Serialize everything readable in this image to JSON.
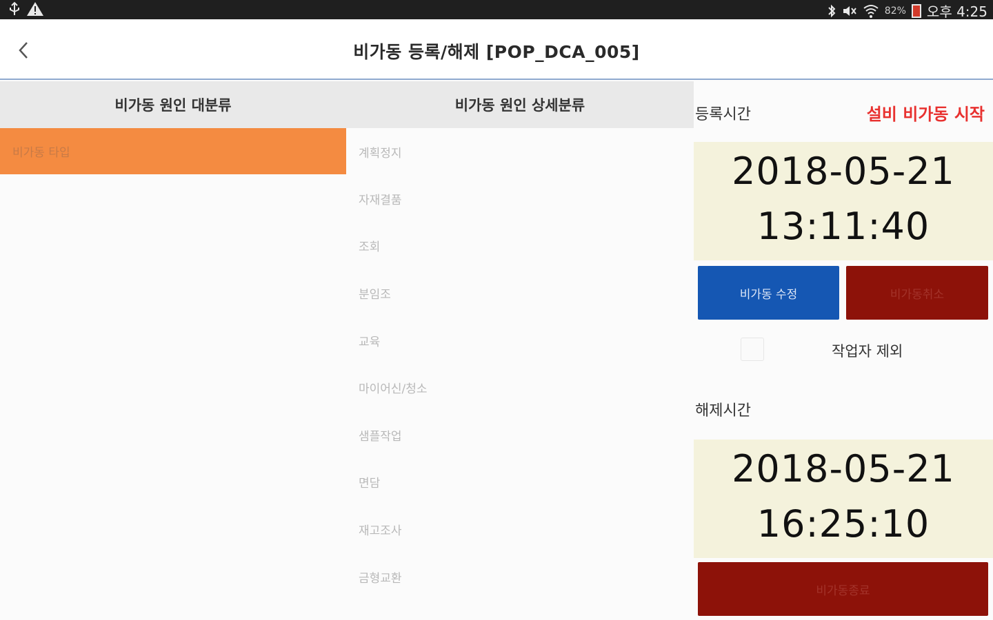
{
  "status_bar": {
    "left_icons": [
      "usb-icon",
      "warning-icon"
    ],
    "battery": "82%",
    "time": "오후 4:25",
    "right_icons": [
      "bluetooth-icon",
      "mute-icon",
      "wifi-icon",
      "battery-icon"
    ]
  },
  "app_bar": {
    "title": "비가동 등록/해제 [POP_DCA_005]",
    "back_icon": "chevron-left-icon"
  },
  "major": {
    "header": "비가동 원인 대분류",
    "items": [
      {
        "label": "비가동 타입",
        "selected": true
      }
    ],
    "accent_color": "#f48b41"
  },
  "detail": {
    "header": "비가동 원인 상세분류",
    "items": [
      "계획정지",
      "자재결품",
      "조회",
      "분임조",
      "교육",
      "마이어신/청소",
      "샘플작업",
      "면담",
      "재고조사",
      "금형교환"
    ]
  },
  "registration": {
    "label": "등록시간",
    "status": "설비 비가동 시작",
    "status_color": "#e8312f",
    "date": "2018-05-21",
    "time": "13:11:40",
    "edit_button": "비가동 수정",
    "cancel_button": "비가동취소",
    "exclude_label": "작업자 제외",
    "exclude_checked": false
  },
  "release": {
    "label": "해제시간",
    "date": "2018-05-21",
    "time": "16:25:10",
    "end_button": "비가동종료"
  },
  "colors": {
    "blue_button": "#1557b3",
    "red_button": "#8d1209",
    "time_box": "#f4f2dc"
  }
}
